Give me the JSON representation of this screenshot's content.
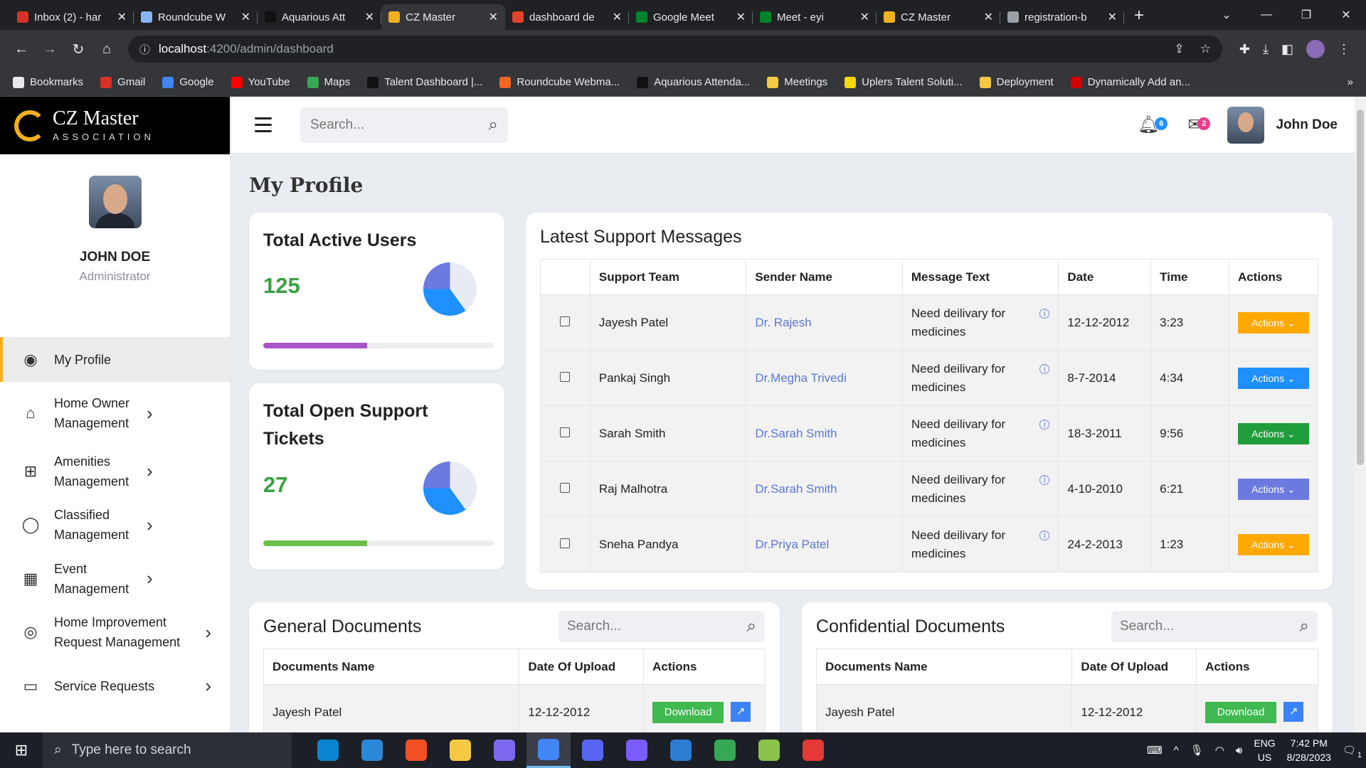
{
  "browser": {
    "tabs": [
      {
        "title": "Inbox (2) - har",
        "color": "#d93025",
        "active": false
      },
      {
        "title": "Roundcube W",
        "color": "#8ab4f8",
        "active": false
      },
      {
        "title": "Aquarious Att",
        "color": "#111111",
        "active": false
      },
      {
        "title": "CZ Master",
        "color": "#f2b01e",
        "active": true
      },
      {
        "title": "dashboard de",
        "color": "#e24329",
        "active": false
      },
      {
        "title": "Google Meet",
        "color": "#00832d",
        "active": false
      },
      {
        "title": "Meet - eyi",
        "color": "#00832d",
        "active": false
      },
      {
        "title": "CZ Master",
        "color": "#f2b01e",
        "active": false
      },
      {
        "title": "registration-b",
        "color": "#9aa0a6",
        "active": false
      }
    ],
    "url_host": "localhost",
    "url_path": ":4200/admin/dashboard",
    "bookmarks": [
      {
        "label": "Bookmarks",
        "color": "#e8eaed"
      },
      {
        "label": "Gmail",
        "color": "#d93025"
      },
      {
        "label": "Google",
        "color": "#4285f4"
      },
      {
        "label": "YouTube",
        "color": "#ff0000"
      },
      {
        "label": "Maps",
        "color": "#34a853"
      },
      {
        "label": "Talent Dashboard |...",
        "color": "#111111"
      },
      {
        "label": "Roundcube Webma...",
        "color": "#f26522"
      },
      {
        "label": "Aquarious Attenda...",
        "color": "#111111"
      },
      {
        "label": "Meetings",
        "color": "#f6c945"
      },
      {
        "label": "Uplers Talent Soluti...",
        "color": "#f5d90a"
      },
      {
        "label": "Deployment",
        "color": "#f6c945"
      },
      {
        "label": "Dynamically Add an...",
        "color": "#d50000"
      }
    ]
  },
  "app": {
    "logo_name": "CZ Master",
    "logo_sub": "ASSOCIATION",
    "search_placeholder": "Search...",
    "notifications_count": "6",
    "messages_count": "2",
    "user_name": "John Doe"
  },
  "sidebar": {
    "profile_name": "JOHN DOE",
    "profile_role": "Administrator",
    "items": [
      {
        "label": "My Profile",
        "icon": "user-circle-icon",
        "glyph": "◉"
      },
      {
        "label": "Home Owner Management",
        "icon": "home-icon",
        "glyph": "⌂"
      },
      {
        "label": "Amenities Management",
        "icon": "sitemap-icon",
        "glyph": "⊞"
      },
      {
        "label": "Classified Management",
        "icon": "chat-icon",
        "glyph": "◯"
      },
      {
        "label": "Event Management",
        "icon": "calendar-icon",
        "glyph": "▦"
      },
      {
        "label": "Home Improvement Request Management",
        "icon": "target-icon",
        "glyph": "◎"
      },
      {
        "label": "Service Requests",
        "icon": "laptop-icon",
        "glyph": "▭"
      }
    ]
  },
  "page": {
    "title": "My Profile",
    "stats": [
      {
        "title": "Total Active Users",
        "value": "125",
        "progress": 0.45,
        "progress_color": "#a855c8"
      },
      {
        "title": "Total Open Support Tickets",
        "value": "27",
        "progress": 0.45,
        "progress_color": "#6cc04a"
      }
    ],
    "support": {
      "title": "Latest Support Messages",
      "columns": [
        "",
        "Support Team",
        "Sender Name",
        "Message Text",
        "Date",
        "Time",
        "Actions"
      ],
      "rows": [
        {
          "team": "Jayesh Patel",
          "sender": "Dr. Rajesh",
          "message": "Need deilivary for medicines",
          "date": "12-12-2012",
          "time": "3:23",
          "action": "Actions",
          "action_color": "#ffa800"
        },
        {
          "team": "Pankaj Singh",
          "sender": "Dr.Megha Trivedi",
          "message": "Need deilivary for medicines",
          "date": "8-7-2014",
          "time": "4:34",
          "action": "Actions",
          "action_color": "#1e90ff"
        },
        {
          "team": "Sarah Smith",
          "sender": "Dr.Sarah Smith",
          "message": "Need deilivary for medicines",
          "date": "18-3-2011",
          "time": "9:56",
          "action": "Actions",
          "action_color": "#1f9d3a"
        },
        {
          "team": "Raj Malhotra",
          "sender": "Dr.Sarah Smith",
          "message": "Need deilivary for medicines",
          "date": "4-10-2010",
          "time": "6:21",
          "action": "Actions",
          "action_color": "#6c7ae0"
        },
        {
          "team": "Sneha Pandya",
          "sender": "Dr.Priya Patel",
          "message": "Need deilivary for medicines",
          "date": "24-2-2013",
          "time": "1:23",
          "action": "Actions",
          "action_color": "#ffa800"
        }
      ]
    },
    "general_docs": {
      "title": "General Documents",
      "search_placeholder": "Search...",
      "columns": [
        "Documents Name",
        "Date Of Upload",
        "Actions"
      ],
      "rows": [
        {
          "name": "Jayesh Patel",
          "date": "12-12-2012",
          "action": "Download"
        }
      ]
    },
    "confidential_docs": {
      "title": "Confidential Documents",
      "search_placeholder": "Search...",
      "columns": [
        "Documents Name",
        "Date Of Upload",
        "Actions"
      ],
      "rows": [
        {
          "name": "Jayesh Patel",
          "date": "12-12-2012",
          "action": "Download"
        }
      ]
    }
  },
  "taskbar": {
    "search_placeholder": "Type here to search",
    "apps": [
      "#0a84d0",
      "#2b88d8",
      "#f25022",
      "#f6c945",
      "#7b68ee",
      "#4285f4",
      "#5865f2",
      "#7b5cff",
      "#2b7cd3",
      "#34a853",
      "#8bc34a",
      "#e53935"
    ],
    "lang1": "ENG",
    "lang2": "US",
    "time": "7:42 PM",
    "date": "8/28/2023",
    "notif_count": "1"
  }
}
